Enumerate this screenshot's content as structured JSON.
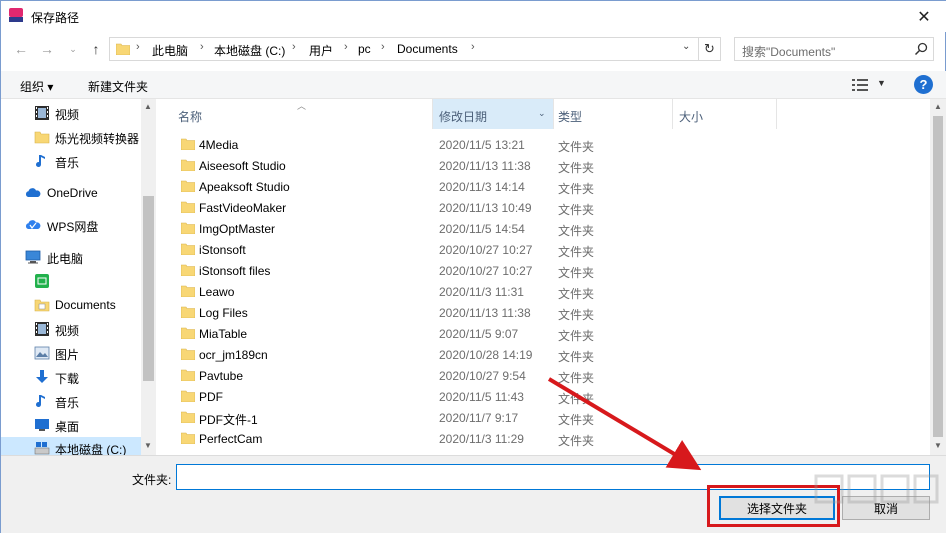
{
  "window": {
    "title": "保存路径",
    "close_glyph": "✕"
  },
  "address": {
    "crumbs": [
      "此电脑",
      "本地磁盘 (C:)",
      "用户",
      "pc",
      "Documents"
    ],
    "search_placeholder": "搜索\"Documents\""
  },
  "toolbar": {
    "organize_label": "组织 ▾",
    "new_folder_label": "新建文件夹",
    "help_glyph": "?"
  },
  "nav": {
    "items": [
      {
        "label": "视频",
        "icon": "video-icon",
        "level": 2
      },
      {
        "label": "烁光视频转换器",
        "icon": "folder-icon",
        "level": 2
      },
      {
        "label": "音乐",
        "icon": "music-icon",
        "level": 2
      },
      {
        "label": "OneDrive",
        "icon": "cloud-icon",
        "level": 1
      },
      {
        "label": "WPS网盘",
        "icon": "wps-cloud-icon",
        "level": 1
      },
      {
        "label": "此电脑",
        "icon": "computer-icon",
        "level": 1
      },
      {
        "label": "",
        "icon": "app-icon",
        "level": 2
      },
      {
        "label": "Documents",
        "icon": "documents-icon",
        "level": 2
      },
      {
        "label": "视频",
        "icon": "video-icon",
        "level": 2
      },
      {
        "label": "图片",
        "icon": "pictures-icon",
        "level": 2
      },
      {
        "label": "下载",
        "icon": "download-icon",
        "level": 2
      },
      {
        "label": "音乐",
        "icon": "music-icon",
        "level": 2
      },
      {
        "label": "桌面",
        "icon": "desktop-icon",
        "level": 2
      },
      {
        "label": "本地磁盘 (C:)",
        "icon": "drive-icon",
        "level": 2,
        "selected": true
      }
    ]
  },
  "list": {
    "columns": {
      "name": "名称",
      "date": "修改日期",
      "type": "类型",
      "size": "大小"
    },
    "rows": [
      {
        "name": "4Media",
        "date": "2020/11/5 13:21",
        "type": "文件夹"
      },
      {
        "name": "Aiseesoft Studio",
        "date": "2020/11/13 11:38",
        "type": "文件夹"
      },
      {
        "name": "Apeaksoft Studio",
        "date": "2020/11/3 14:14",
        "type": "文件夹"
      },
      {
        "name": "FastVideoMaker",
        "date": "2020/11/13 10:49",
        "type": "文件夹"
      },
      {
        "name": "ImgOptMaster",
        "date": "2020/11/5 14:54",
        "type": "文件夹"
      },
      {
        "name": "iStonsoft",
        "date": "2020/10/27 10:27",
        "type": "文件夹"
      },
      {
        "name": "iStonsoft files",
        "date": "2020/10/27 10:27",
        "type": "文件夹"
      },
      {
        "name": "Leawo",
        "date": "2020/11/3 11:31",
        "type": "文件夹"
      },
      {
        "name": "Log Files",
        "date": "2020/11/13 11:38",
        "type": "文件夹"
      },
      {
        "name": "MiaTable",
        "date": "2020/11/5 9:07",
        "type": "文件夹"
      },
      {
        "name": "ocr_jm189cn",
        "date": "2020/10/28 14:19",
        "type": "文件夹"
      },
      {
        "name": "Pavtube",
        "date": "2020/10/27 9:54",
        "type": "文件夹"
      },
      {
        "name": "PDF",
        "date": "2020/11/5 11:43",
        "type": "文件夹"
      },
      {
        "name": "PDF文件-1",
        "date": "2020/11/7 9:17",
        "type": "文件夹"
      },
      {
        "name": "PerfectCam",
        "date": "2020/11/3 11:29",
        "type": "文件夹"
      }
    ]
  },
  "bottom": {
    "folder_label": "文件夹:",
    "folder_value": "",
    "select_button": "选择文件夹",
    "cancel_button": "取消"
  },
  "colors": {
    "accent": "#0078d7",
    "annotation_red": "#d7191c",
    "folder_yellow": "#f8d775"
  }
}
